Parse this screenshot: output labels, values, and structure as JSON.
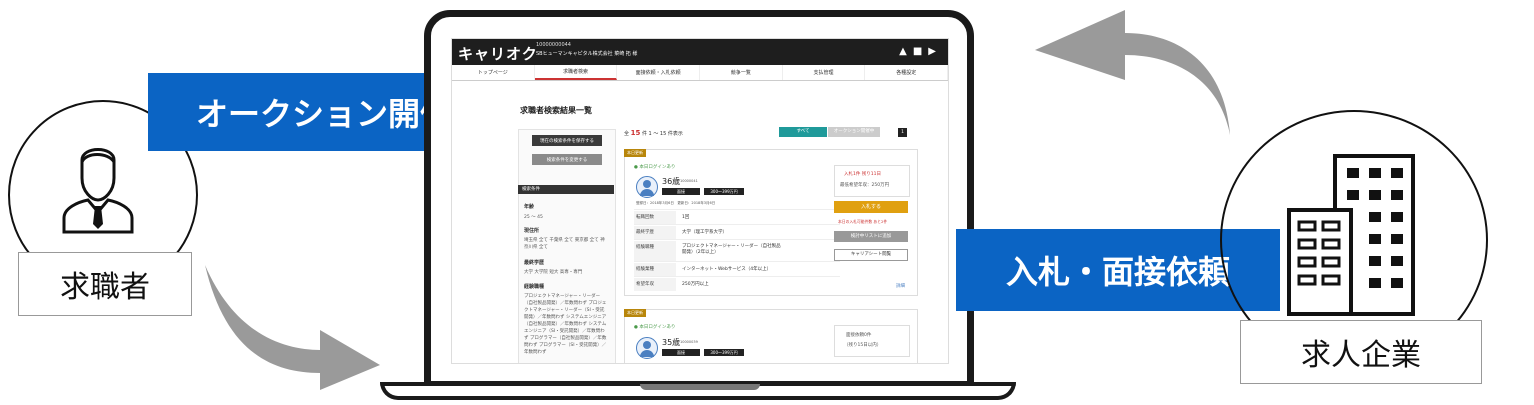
{
  "labels": {
    "auction": "オークション開催",
    "job_seeker": "求職者",
    "bid": "入札・面接依頼",
    "company": "求人企業"
  },
  "colors": {
    "accent": "#0b64c4",
    "arrow": "#9a9a9a"
  },
  "icons": {
    "person": "person-tie-icon",
    "building": "office-building-icon",
    "laptop": "laptop-icon"
  },
  "screen": {
    "logo": "キャリオク",
    "company_id": "10000000044",
    "company_name": "SBヒューマンキャピタル株式会社 菜崎 拓 様",
    "nav": [
      "トップページ",
      "求職者検索",
      "面接依頼・入札依頼",
      "競争一覧",
      "支払管理",
      "各種設定"
    ],
    "page_title": "求職者検索結果一覧",
    "save_btn": "現在の検索条件を保存する",
    "change_btn": "検索条件を変更する",
    "conditions_header": "検索条件",
    "cond_age_label": "年齢",
    "cond_age_value": "25 〜 45",
    "cond_location_label": "現住所",
    "cond_location_value": "埼玉県 全て 千葉県 全て 東京都 全て 神奈川県 全て",
    "cond_edu_label": "最終学歴",
    "cond_edu_value": "大学 大学院 短大 高専・専門",
    "cond_exp_label": "経験職種",
    "cond_exp_value": "プロジェクトマネージャー・リーダー（自社製品開発）／年数問わず プロジェクトマネージャー・リーダー（SI・受託開発）／年数問わず システムエンジニア（自社製品開発）／年数問わず システムエンジニア（SI・受託開発）／年数問わず プログラマー（自社製品開発）／年数問わず プログラマー（SI・受託開発）／年数問わず",
    "count_text_pre": "全",
    "count_num": "15",
    "count_text_post": "件 1 〜 15 件表示",
    "tab_all": "すべて",
    "tab_auction": "オークション開催中",
    "page_num": "1",
    "card1": {
      "badge": "本日更新",
      "login": "● 本日ログインあり",
      "age": "36歳",
      "id": "10000041",
      "tag1": "面接",
      "tag2": "300〜399万円",
      "dates": "登録日：2018年3月6日　更新日：2018年3月6日",
      "rows": [
        {
          "k": "転職回数",
          "v": "1回"
        },
        {
          "k": "最終学歴",
          "v": "大学（理工学系大学）"
        },
        {
          "k": "経験職種",
          "v": "プロジェクトマネージャー・リーダー（自社製品開発）（2年以上）"
        },
        {
          "k": "経験業種",
          "v": "インターネット・Webサービス（4年以上）"
        },
        {
          "k": "希望年収",
          "v": "250万円以上"
        }
      ],
      "bid_info": "入札1件 残り11日",
      "min_salary": "最低希望年収：250万円",
      "bid_btn": "入札する",
      "bid_note": "本日の入札可能件数 あと2件",
      "consider_btn": "検討中リストに追加",
      "sheet_btn": "キャリアシート閲覧",
      "more": "詳細"
    },
    "card2": {
      "badge": "本日更新",
      "login": "● 本日ログインあり",
      "age": "35歳",
      "id": "10000039",
      "tag1": "面接",
      "tag2": "300〜399万円",
      "bid_info": "面接依頼0件",
      "remain": "（残り15日以内）"
    }
  }
}
